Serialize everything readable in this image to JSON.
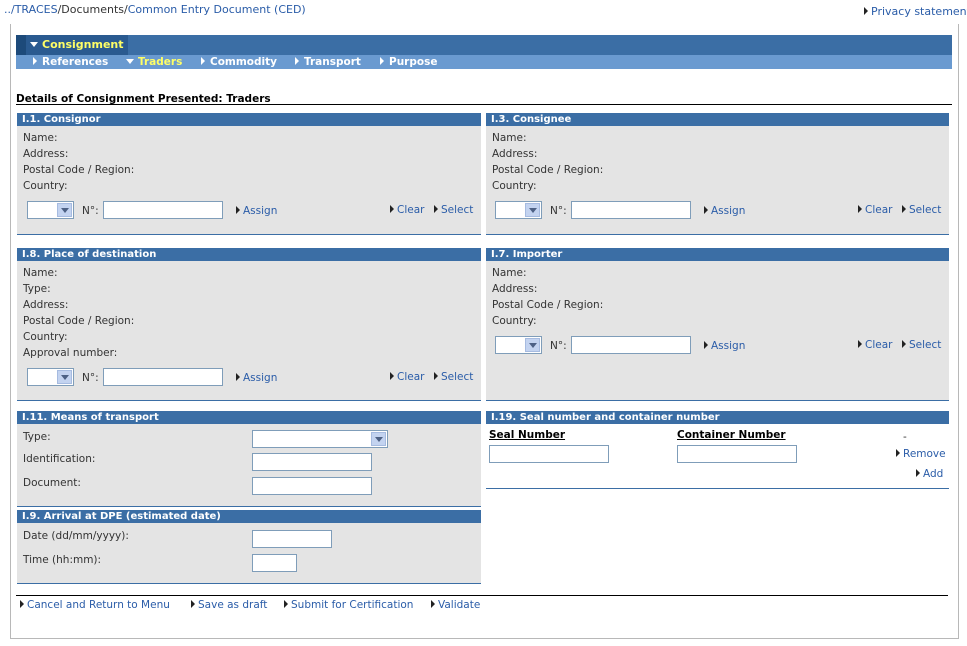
{
  "breadcrumb": {
    "prefix": "../",
    "traces": "TRACES",
    "documents": "Documents",
    "current": "Common Entry Document (CED)"
  },
  "privacy": "Privacy statement",
  "menu": {
    "main": "Consignment",
    "tabs": [
      "References",
      "Traders",
      "Commodity",
      "Transport",
      "Purpose"
    ],
    "active_tab": "Traders"
  },
  "section_title": "Details of Consignment Presented: Traders",
  "labels": {
    "name": "Name:",
    "address": "Address:",
    "postal": "Postal Code / Region:",
    "country": "Country:",
    "type": "Type:",
    "approval": "Approval number:",
    "number": "N°:",
    "assign": "Assign",
    "clear": "Clear",
    "select": "Select"
  },
  "panels": {
    "consignor": "I.1. Consignor",
    "consignee": "I.3. Consignee",
    "destination": "I.8. Place of destination",
    "importer": "I.7. Importer",
    "transport": "I.11. Means of transport",
    "seal": "I.19. Seal number and container number",
    "arrival": "I.9. Arrival at DPE (estimated date)"
  },
  "transport_fields": {
    "type": "Type:",
    "identification": "Identification:",
    "document": "Document:"
  },
  "seal_fields": {
    "seal_number": "Seal Number",
    "container_number": "Container Number",
    "dash": "-",
    "remove": "Remove",
    "add": "Add"
  },
  "arrival_fields": {
    "date": "Date (dd/mm/yyyy):",
    "time": "Time (hh:mm):"
  },
  "actions": {
    "cancel": "Cancel and Return to Menu",
    "save": "Save as draft",
    "submit": "Submit for Certification",
    "validate": "Validate"
  }
}
